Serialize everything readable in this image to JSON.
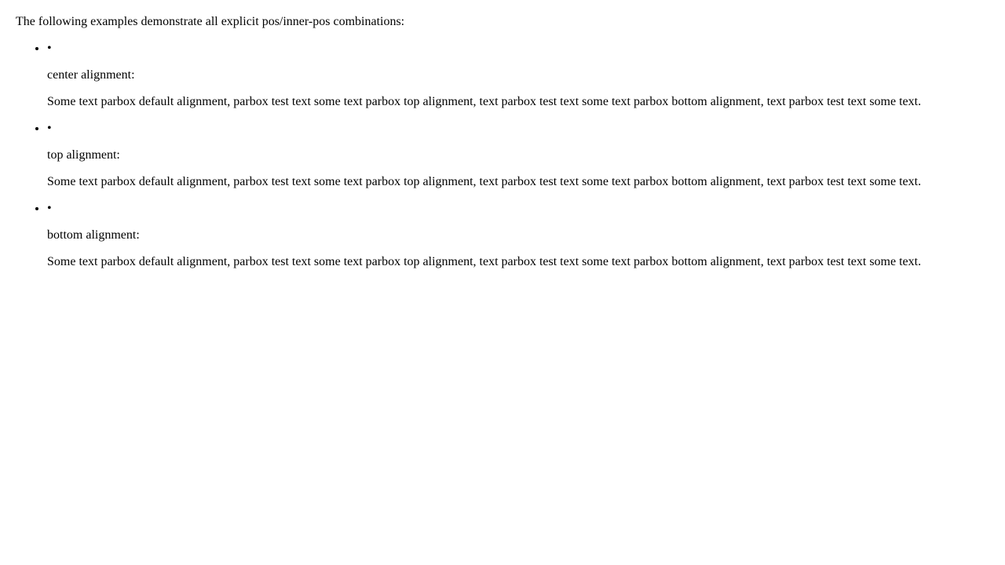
{
  "document": {
    "intro": "The following examples demonstrate all explicit pos/inner-pos combinations:",
    "items": [
      {
        "bullet": "•",
        "heading": "center alignment:",
        "text": "Some text parbox default alignment, parbox test text some text parbox top alignment, text parbox test text some text parbox bottom alignment, text parbox test text some text."
      },
      {
        "bullet": "•",
        "heading": "top alignment:",
        "text": "Some text parbox default alignment, parbox test text some text parbox top alignment, text parbox test text some text parbox bottom alignment, text parbox test text some text."
      },
      {
        "bullet": "•",
        "heading": "bottom alignment:",
        "text": "Some text parbox default alignment, parbox test text some text parbox top alignment, text parbox test text some text parbox bottom alignment, text parbox test text some text."
      }
    ]
  }
}
